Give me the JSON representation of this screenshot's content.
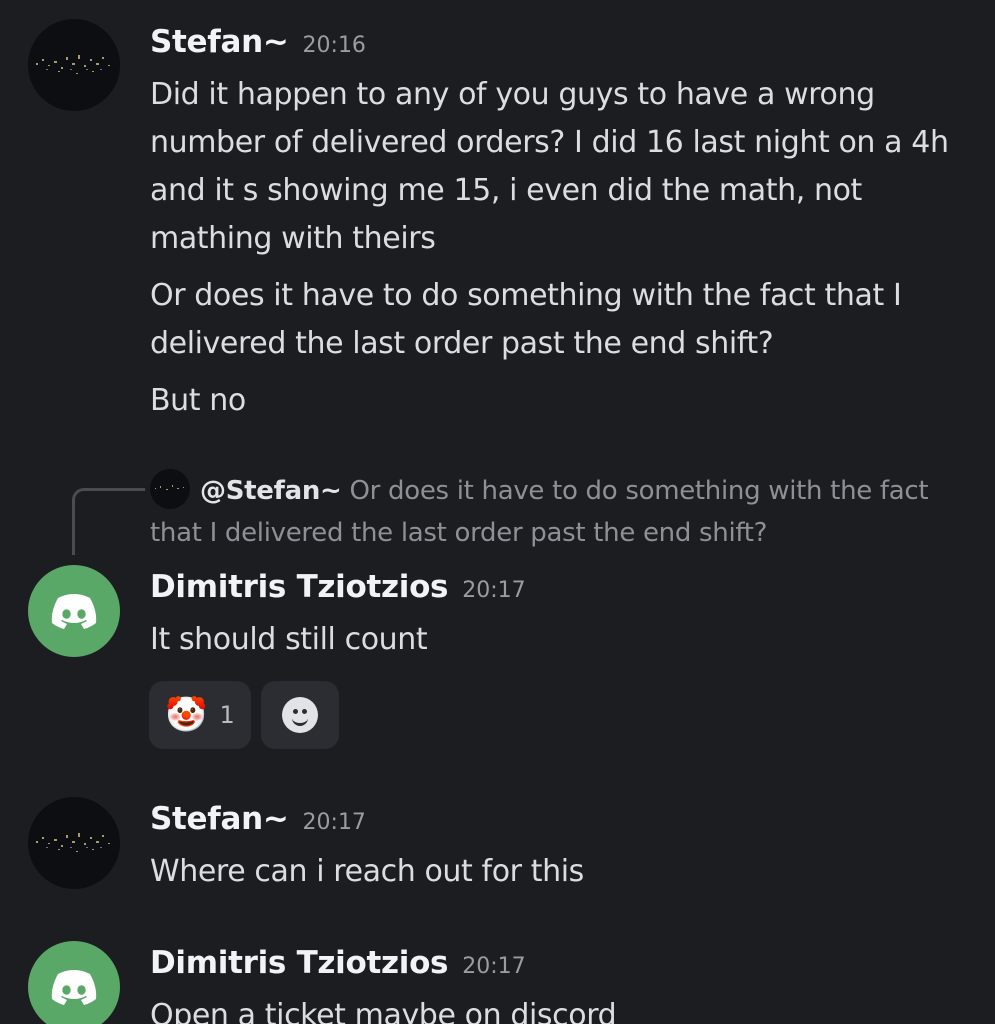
{
  "messages": [
    {
      "author": "Stefan~",
      "time": "20:16",
      "avatar": "night-city-avatar",
      "paragraphs": [
        "Did it happen to any of you guys to have a wrong number of delivered orders? I did 16 last night on a 4h and it s showing me 15, i even did the math, not mathing with theirs",
        "Or does it have to do something with the fact that I delivered the last order past the end shift?",
        "But no"
      ]
    },
    {
      "reply": {
        "author": "@Stefan~",
        "text": "Or does it have to do something with the fact that I delivered the last order past the end shift?"
      },
      "author": "Dimitris Tziotzios",
      "time": "20:17",
      "avatar": "discord-avatar",
      "paragraphs": [
        "It should still count"
      ],
      "reactions": [
        {
          "emoji": "🤡",
          "count": "1",
          "icon": "clown-emoji-icon"
        },
        {
          "icon": "add-reaction-icon"
        }
      ]
    },
    {
      "author": "Stefan~",
      "time": "20:17",
      "avatar": "night-city-avatar",
      "paragraphs": [
        "Where can i reach out for this"
      ]
    },
    {
      "author": "Dimitris Tziotzios",
      "time": "20:17",
      "avatar": "discord-avatar",
      "paragraphs": [
        "Open a ticket maybe on discord"
      ]
    }
  ],
  "colors": {
    "background": "#1c1d21",
    "discord_avatar": "#5aa868",
    "reaction_bg": "#2b2d33"
  }
}
